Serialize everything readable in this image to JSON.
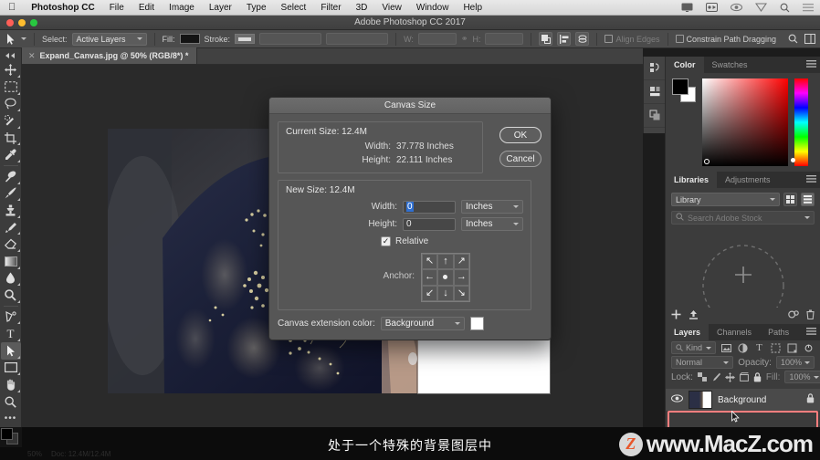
{
  "os_menu": {
    "apple": "apple-logo",
    "items": [
      "Photoshop CC",
      "File",
      "Edit",
      "Image",
      "Layer",
      "Type",
      "Select",
      "Filter",
      "3D",
      "View",
      "Window",
      "Help"
    ],
    "status_icons": [
      "display-icon",
      "screenshot-icon",
      "eye-icon",
      "shield-icon",
      "search-icon",
      "list-icon"
    ]
  },
  "window": {
    "title": "Adobe Photoshop CC 2017"
  },
  "options_bar": {
    "tool_preset": "path-selection-tool",
    "select_label": "Select:",
    "select_value": "Active Layers",
    "fill_label": "Fill:",
    "fill_color": "#141414",
    "stroke_label": "Stroke:",
    "stroke_width": "",
    "width_label": "W:",
    "width_value": "",
    "link_icon": "link-icon",
    "height_label": "H:",
    "height_value": "",
    "path_ops_icon": "path-operations-icon",
    "path_align_icon": "path-alignment-icon",
    "path_arrange_icon": "path-arrangement-icon",
    "align_edges_label": "Align Edges",
    "constrain_label": "Constrain Path Dragging"
  },
  "document": {
    "tab_title": "Expand_Canvas.jpg @ 50% (RGB/8*) *",
    "close_icon": "close-icon"
  },
  "tools": [
    {
      "name": "move-tool",
      "glyph": "✥"
    },
    {
      "name": "rectangular-marquee-tool",
      "glyph": "▭"
    },
    {
      "name": "lasso-tool",
      "glyph": "◠"
    },
    {
      "name": "quick-selection-tool",
      "glyph": "✒"
    },
    {
      "name": "crop-tool",
      "glyph": "⌗"
    },
    {
      "name": "eyedropper-tool",
      "glyph": "⌇"
    },
    {
      "name": "spot-healing-brush-tool",
      "glyph": "✇"
    },
    {
      "name": "brush-tool",
      "glyph": "✎"
    },
    {
      "name": "clone-stamp-tool",
      "glyph": "⎙"
    },
    {
      "name": "history-brush-tool",
      "glyph": "✐"
    },
    {
      "name": "eraser-tool",
      "glyph": "◧"
    },
    {
      "name": "gradient-tool",
      "glyph": "▤"
    },
    {
      "name": "blur-tool",
      "glyph": "💧"
    },
    {
      "name": "dodge-tool",
      "glyph": "⚲"
    },
    {
      "name": "pen-tool",
      "glyph": "✑"
    },
    {
      "name": "type-tool",
      "glyph": "T"
    },
    {
      "name": "path-selection-tool",
      "glyph": "➤"
    },
    {
      "name": "rectangle-tool",
      "glyph": "▭"
    },
    {
      "name": "hand-tool",
      "glyph": "✋"
    },
    {
      "name": "zoom-tool",
      "glyph": "🔍"
    },
    {
      "name": "edit-toolbar-tool",
      "glyph": "•••"
    }
  ],
  "dialog": {
    "title": "Canvas Size",
    "current_size_label": "Current Size: 12.4M",
    "current_width_label": "Width:",
    "current_width_value": "37.778 Inches",
    "current_height_label": "Height:",
    "current_height_value": "22.111 Inches",
    "new_size_label": "New Size: 12.4M",
    "new_width_label": "Width:",
    "new_width_value": "0",
    "new_width_unit": "Inches",
    "new_height_label": "Height:",
    "new_height_value": "0",
    "new_height_unit": "Inches",
    "relative_label": "Relative",
    "relative_checked": true,
    "anchor_label": "Anchor:",
    "anchor_cells": [
      "↖",
      "↑",
      "↗",
      "←",
      "•",
      "→",
      "↙",
      "↓",
      "↘"
    ],
    "anchor_selected_index": 4,
    "extension_label": "Canvas extension color:",
    "extension_value": "Background",
    "extension_swatch": "#ffffff",
    "ok_label": "OK",
    "cancel_label": "Cancel"
  },
  "panels": {
    "color": {
      "tabs": [
        "Color",
        "Swatches"
      ],
      "active_tab": "Color",
      "foreground": "#000000",
      "background": "#ffffff",
      "menu_icon": "panel-menu-icon"
    },
    "libraries": {
      "tabs": [
        "Libraries",
        "Adjustments"
      ],
      "active_tab": "Libraries",
      "library_value": "Library",
      "search_placeholder": "Search Adobe Stock",
      "grid_view_icon": "grid-view-icon",
      "list_view_icon": "list-view-icon",
      "add_icon": "add-icon",
      "upload_icon": "upload-icon",
      "sync_icon": "sync-icon",
      "delete_icon": "delete-icon",
      "menu_icon": "panel-menu-icon"
    },
    "layers": {
      "tabs": [
        "Layers",
        "Channels",
        "Paths"
      ],
      "active_tab": "Layers",
      "filter_label": "Kind",
      "filter_icons": [
        "pixel-filter-icon",
        "adjustment-filter-icon",
        "type-filter-icon",
        "shape-filter-icon",
        "smart-object-filter-icon"
      ],
      "filter_toggle_icon": "filter-power-icon",
      "blend_mode": "Normal",
      "opacity_label": "Opacity:",
      "opacity_value": "100%",
      "lock_label": "Lock:",
      "lock_icons": [
        "lock-transparency-icon",
        "lock-image-icon",
        "lock-position-icon",
        "lock-artboard-icon",
        "lock-all-icon"
      ],
      "fill_label": "Fill:",
      "fill_value": "100%",
      "rows": [
        {
          "name": "Background",
          "visible": true,
          "locked": true,
          "highlighted": true
        }
      ],
      "menu_icon": "panel-menu-icon"
    },
    "dock_icons": [
      "history-panel-icon",
      "properties-panel-icon",
      "layer-comps-panel-icon"
    ]
  },
  "status_bar": {
    "zoom": "50%",
    "doc_info": "Doc: 12.4M/12.4M"
  },
  "overlay": {
    "subtitle": "处于一个特殊的背景图层中",
    "watermark_logo": "z-logo",
    "watermark_text": "www.MacZ.com"
  },
  "colors": {
    "accent_blue": "#2f6fd0",
    "highlight_red": "#ff7e7e",
    "panel_bg": "#3c3c3c",
    "dialog_bg": "#565656"
  }
}
